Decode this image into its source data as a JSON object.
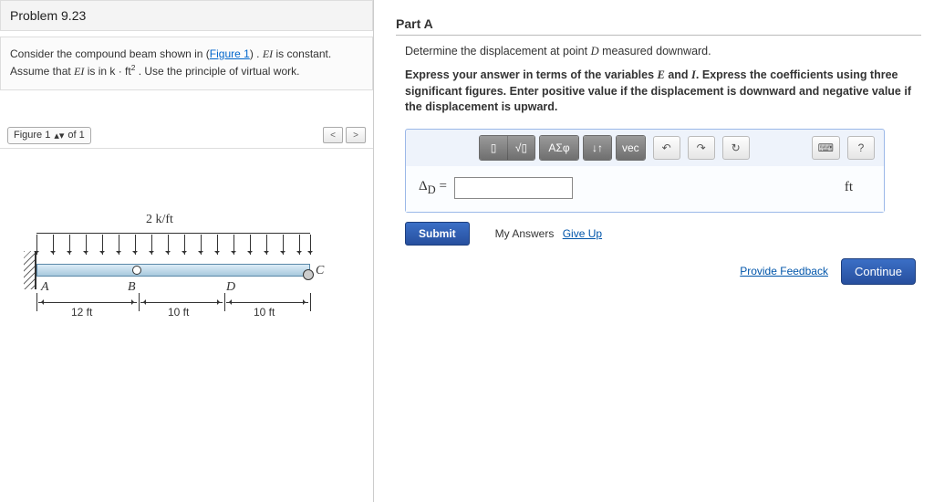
{
  "left": {
    "title": "Problem 9.23",
    "desc_1": "Consider the compound beam shown in (",
    "desc_link": "Figure 1",
    "desc_2": ") . ",
    "ei_1": "EI",
    "desc_3": " is constant. Assume that ",
    "ei_2": "EI",
    "desc_4": " is in k · ft",
    "exp": "2",
    "desc_5": " . Use the principle of virtual work.",
    "figure_label": "Figure 1",
    "of_text": "of 1",
    "load": "2 k/ft",
    "ptA": "A",
    "ptB": "B",
    "ptC": "C",
    "ptD": "D",
    "dim1": "12 ft",
    "dim2": "10 ft",
    "dim3": "10 ft"
  },
  "right": {
    "part": "Part A",
    "prompt_1": "Determine the displacement at point ",
    "prompt_var": "D",
    "prompt_2": " measured downward.",
    "instr_1": "Express your answer in terms of the variables ",
    "ivar_E": "E",
    "instr_and": " and ",
    "ivar_I": "I",
    "instr_2": ". Express the coefficients using three significant figures. Enter positive value if the displacement is downward and negative value if the displacement is upward.",
    "toolbar": {
      "templates": "▯",
      "frac": "√▯",
      "greek": "ΑΣφ",
      "subsup": "↓↑",
      "vec": "vec",
      "undo": "↶",
      "redo": "↷",
      "reset": "↻",
      "keyboard": "⌨",
      "help": "?"
    },
    "answer_label": "Δ",
    "answer_sub": "D",
    "equals": " = ",
    "unit": "ft",
    "submit": "Submit",
    "myans": "My Answers",
    "giveup": "Give Up",
    "feedback": "Provide Feedback",
    "continue": "Continue"
  }
}
